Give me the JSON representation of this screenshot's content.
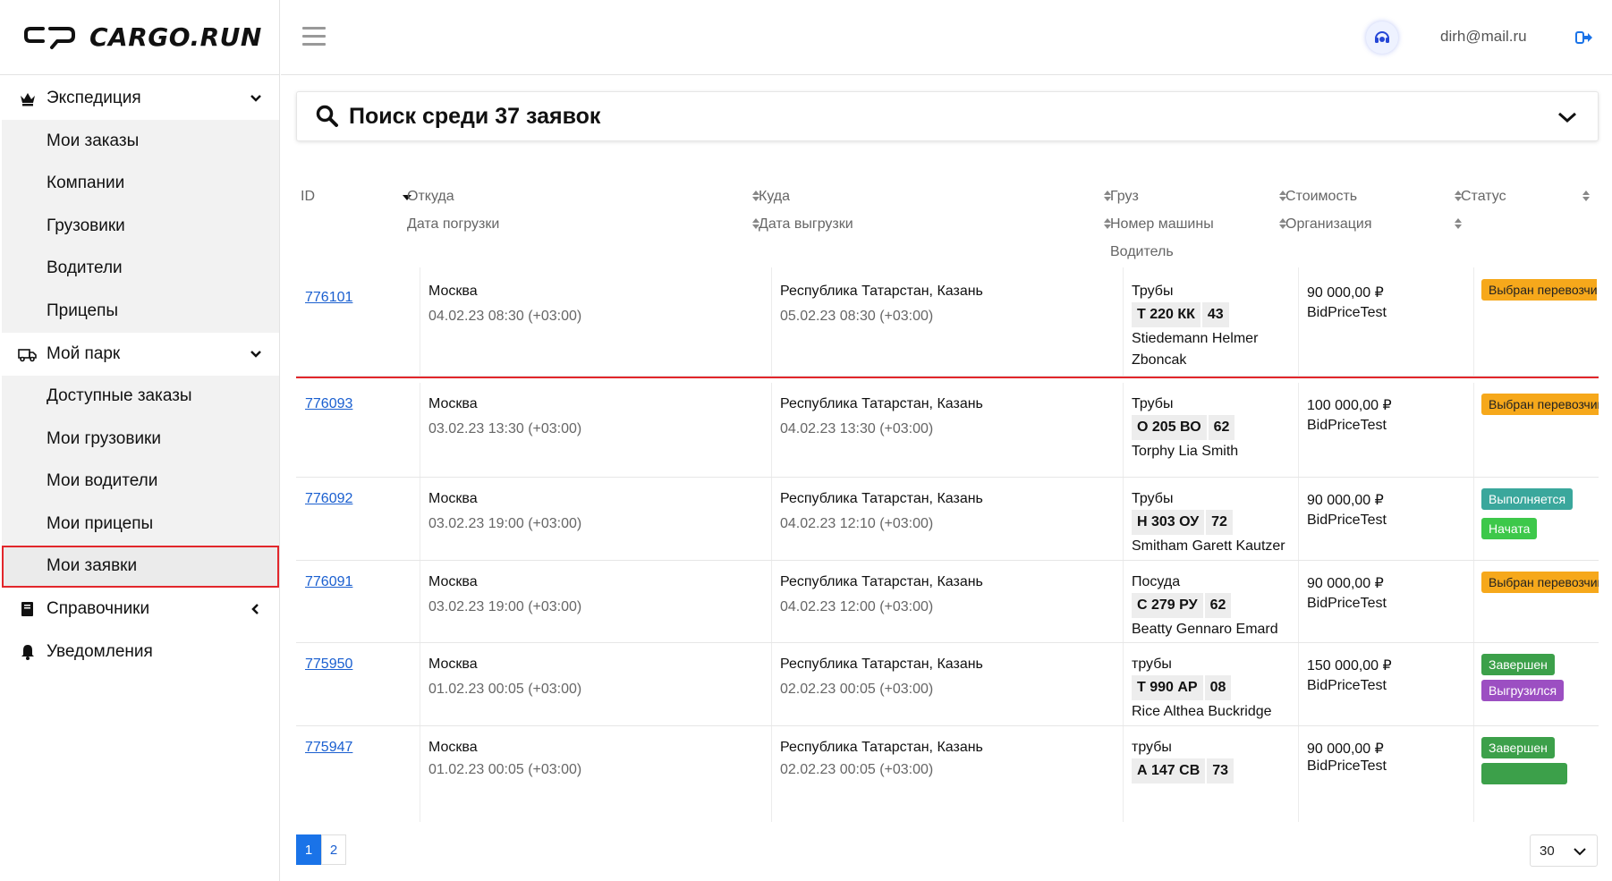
{
  "brand": {
    "name": "CARGO.RUN"
  },
  "header": {
    "user_email": "dirh@mail.ru"
  },
  "sidebar": {
    "groups": [
      {
        "label": "Экспедиция",
        "icon": "crown-icon",
        "expanded": true,
        "items": [
          {
            "label": "Мои заказы"
          },
          {
            "label": "Компании"
          },
          {
            "label": "Грузовики"
          },
          {
            "label": "Водители"
          },
          {
            "label": "Прицепы"
          }
        ]
      },
      {
        "label": "Мой парк",
        "icon": "truck-icon",
        "expanded": true,
        "items": [
          {
            "label": "Доступные заказы"
          },
          {
            "label": "Мои грузовики"
          },
          {
            "label": "Мои водители"
          },
          {
            "label": "Мои прицепы"
          },
          {
            "label": "Мои заявки"
          }
        ]
      },
      {
        "label": "Справочники",
        "icon": "book-icon",
        "expanded": false
      },
      {
        "label": "Уведомления",
        "icon": "bell-icon",
        "expanded": false
      }
    ]
  },
  "search": {
    "label": "Поиск среди 37 заявок"
  },
  "table": {
    "headers": {
      "id": "ID",
      "from": "Откуда",
      "load_date": "Дата погрузки",
      "to": "Куда",
      "unload_date": "Дата выгрузки",
      "cargo": "Груз",
      "truck_number": "Номер машины",
      "driver": "Водитель",
      "price": "Стоимость",
      "org": "Организация",
      "status": "Статус"
    },
    "rows": [
      {
        "id": "776101",
        "from": "Москва",
        "load_date": "04.02.23 08:30 (+03:00)",
        "to": "Республика Татарстан, Казань",
        "unload_date": "05.02.23 08:30 (+03:00)",
        "cargo": "Трубы",
        "plate_num": "Т 220 КК",
        "plate_region": "43",
        "driver": [
          "Stiedemann Helmer",
          "Zboncak"
        ],
        "price": "90 000,00 ₽",
        "org": "BidPriceTest",
        "statuses": [
          {
            "label": "Выбран перевозчик",
            "color": "#f6a81b"
          }
        ]
      },
      {
        "id": "776093",
        "from": "Москва",
        "load_date": "03.02.23 13:30 (+03:00)",
        "to": "Республика Татарстан, Казань",
        "unload_date": "04.02.23 13:30 (+03:00)",
        "cargo": "Трубы",
        "plate_num": "О 205 ВО",
        "plate_region": "62",
        "driver": [
          "Torphy Lia Smith"
        ],
        "price": "100 000,00 ₽",
        "org": "BidPriceTest",
        "statuses": [
          {
            "label": "Выбран перевозчик",
            "color": "#f6a81b"
          }
        ]
      },
      {
        "id": "776092",
        "from": "Москва",
        "load_date": "03.02.23 19:00 (+03:00)",
        "to": "Республика Татарстан, Казань",
        "unload_date": "04.02.23 12:10 (+03:00)",
        "cargo": "Трубы",
        "plate_num": "Н 303 ОУ",
        "plate_region": "72",
        "driver": [
          "Smitham Garett Kautzer"
        ],
        "price": "90 000,00 ₽",
        "org": "BidPriceTest",
        "statuses": [
          {
            "label": "Выполняется",
            "color": "#3aa79c"
          },
          {
            "label": "Начата",
            "color": "#3dc84a"
          }
        ]
      },
      {
        "id": "776091",
        "from": "Москва",
        "load_date": "03.02.23 19:00 (+03:00)",
        "to": "Республика Татарстан, Казань",
        "unload_date": "04.02.23 12:00 (+03:00)",
        "cargo": "Посуда",
        "plate_num": "С 279 РУ",
        "plate_region": "62",
        "driver": [
          "Beatty Gennaro Emard"
        ],
        "price": "90 000,00 ₽",
        "org": "BidPriceTest",
        "statuses": [
          {
            "label": "Выбран перевозчик",
            "color": "#f6a81b"
          }
        ]
      },
      {
        "id": "775950",
        "from": "Москва",
        "load_date": "01.02.23 00:05 (+03:00)",
        "to": "Республика Татарстан, Казань",
        "unload_date": "02.02.23 00:05 (+03:00)",
        "cargo": "трубы",
        "plate_num": "Т 990 АР",
        "plate_region": "08",
        "driver": [
          "Rice Althea Buckridge"
        ],
        "price": "150 000,00 ₽",
        "org": "BidPriceTest",
        "statuses": [
          {
            "label": "Завершен",
            "color": "#3ca04a"
          },
          {
            "label": "Выгрузился",
            "color": "#9c4fc2"
          }
        ]
      },
      {
        "id": "775947",
        "from": "Москва",
        "load_date": "01.02.23 00:05 (+03:00)",
        "to": "Республика Татарстан, Казань",
        "unload_date": "02.02.23 00:05 (+03:00)",
        "cargo": "трубы",
        "plate_num": "А 147 СВ",
        "plate_region": "73",
        "driver": [
          ""
        ],
        "price": "90 000,00 ₽",
        "org": "BidPriceTest",
        "statuses": [
          {
            "label": "Завершен",
            "color": "#3ca04a"
          },
          {
            "label": "",
            "color": "#3ca04a"
          }
        ]
      }
    ]
  },
  "pagination": {
    "pages": [
      "1",
      "2"
    ],
    "current": "1",
    "per_page": "30"
  }
}
